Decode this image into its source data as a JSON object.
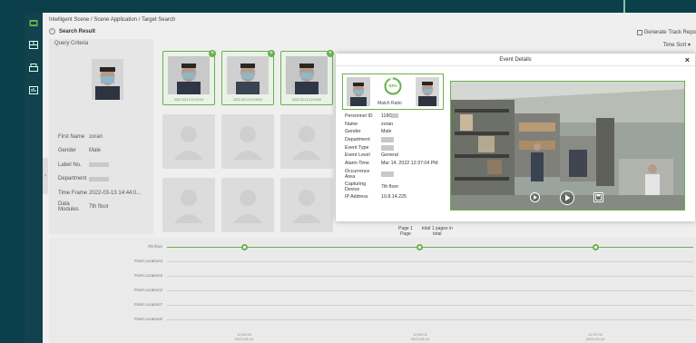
{
  "breadcrumb": "Intelligent Scene / Scene Application / Target Search",
  "section_title": "Search Result",
  "toolbar": {
    "generate_label": "Generate Track Repo",
    "sort_label": "Time Sort"
  },
  "query": {
    "title": "Query Criteria",
    "fields": [
      {
        "label": "First Name",
        "value": "zoran"
      },
      {
        "label": "Gender",
        "value": "Male"
      },
      {
        "label": "Label No.",
        "value": ""
      },
      {
        "label": "Department",
        "value": ""
      },
      {
        "label": "Time Frame",
        "value": "2022-03-13 14:44:0..."
      },
      {
        "label": "Data Modules",
        "value": "7th floor"
      }
    ]
  },
  "results": [
    {
      "timestamp": "2022-03-14 12:37:04"
    },
    {
      "timestamp": "2022-03-14 12:09:01"
    },
    {
      "timestamp": "2022-03-14 12:03:00"
    }
  ],
  "pager": {
    "page_line1": "Page 1",
    "page_line2": "Page",
    "total_line1": "total 1 pages in",
    "total_line2": "total"
  },
  "timeline": {
    "rows": [
      "7th floor",
      "Point Location4",
      "Point Location3",
      "Point Location2",
      "Point Location7",
      "Point Location0"
    ],
    "ticks": [
      {
        "time": "12:03:00",
        "date": "2022-03-14"
      },
      {
        "time": "12:09:01",
        "date": "2022-03-14"
      },
      {
        "time": "12:37:04",
        "date": "2022-03-14"
      }
    ]
  },
  "dialog": {
    "title": "Event Details",
    "close": "×",
    "match_pct": "93%",
    "match_label": "Match Ratio",
    "details": [
      {
        "label": "Personnel ID",
        "value": "1180"
      },
      {
        "label": "Name",
        "value": "zoran"
      },
      {
        "label": "Gender",
        "value": "Male"
      },
      {
        "label": "Department",
        "value": ""
      },
      {
        "label": "Event Type",
        "value": ""
      },
      {
        "label": "Event Level",
        "value": "General"
      },
      {
        "label": "Alarm Time",
        "value": "Mar 14, 2022 12:37:04 PM"
      },
      {
        "label": "Occurrence Area",
        "value": ""
      },
      {
        "label": "Capturing Device",
        "value": "7th floor"
      },
      {
        "label": "IP Address",
        "value": "10.8.14.225"
      }
    ]
  },
  "colors": {
    "accent": "#6ab04c",
    "rail": "#12424d",
    "header": "#0b3f4a"
  }
}
